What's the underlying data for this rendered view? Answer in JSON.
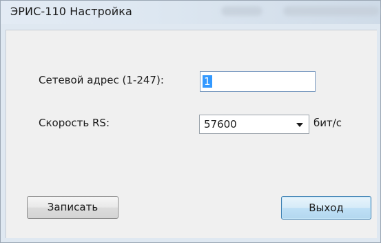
{
  "window": {
    "title": "ЭРИС-110 Настройка"
  },
  "form": {
    "address_label": "Сетевой адрес (1-247):",
    "address_value": "1",
    "speed_label": "Скорость RS:",
    "speed_value": "57600",
    "speed_unit": "бит/с"
  },
  "buttons": {
    "write_label": "Записать",
    "exit_label": "Выход"
  },
  "colors": {
    "selection": "#3399ff",
    "default_button_border": "#3c7fb1"
  }
}
